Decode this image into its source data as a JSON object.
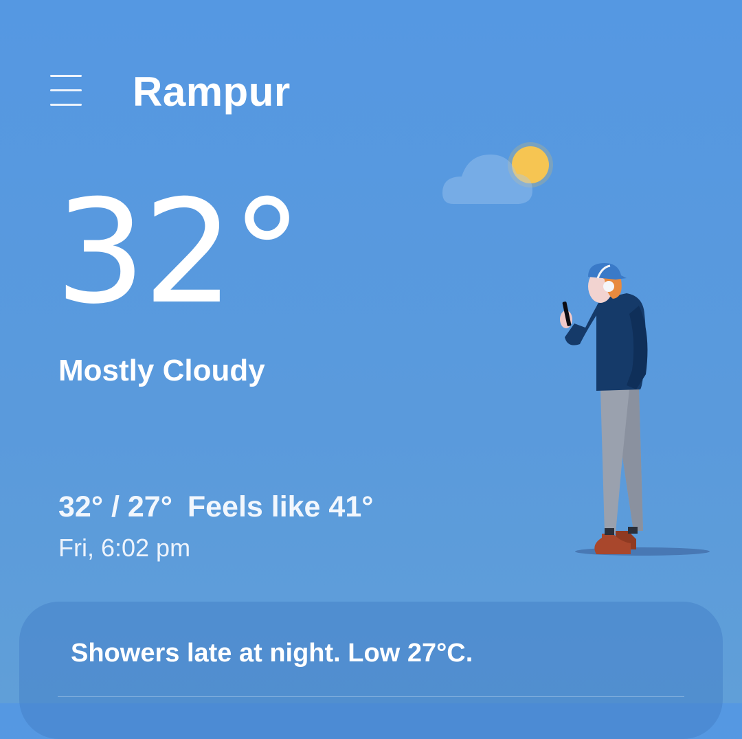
{
  "header": {
    "menu_icon": "hamburger-menu-icon",
    "city": "Rampur"
  },
  "current": {
    "temperature": "32°",
    "condition": "Mostly Cloudy",
    "high_low": "32° / 27°",
    "feels_like": "Feels like 41°",
    "datetime": "Fri, 6:02 pm"
  },
  "illustration": {
    "weather_icon": "sun-behind-cloud-icon",
    "figure": "person-with-phone-and-headphones"
  },
  "summary": {
    "text": "Showers late at night. Low 27°C."
  },
  "colors": {
    "background_top": "#5598e2",
    "background_bottom": "#609fd8",
    "card": "#4e8fd2",
    "sun": "#f6c552",
    "jacket": "#153a69",
    "pants": "#9aa1ae",
    "shoes": "#a9472c"
  }
}
